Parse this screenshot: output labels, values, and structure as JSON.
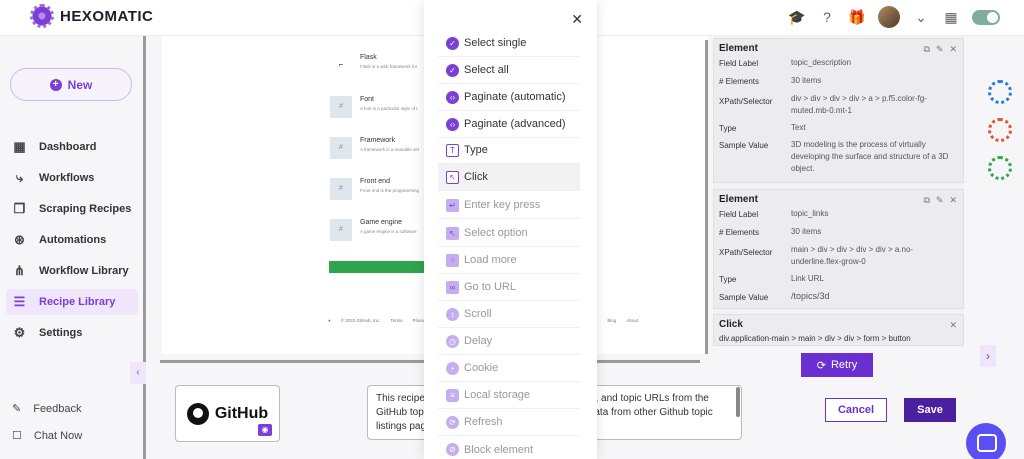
{
  "app": {
    "name": "HEXOMATIC"
  },
  "sidebar": {
    "new_label": "New",
    "items": [
      {
        "label": "Dashboard",
        "icon": "dashboard-icon"
      },
      {
        "label": "Workflows",
        "icon": "workflow-icon"
      },
      {
        "label": "Scraping Recipes",
        "icon": "recipe-icon"
      },
      {
        "label": "Automations",
        "icon": "automation-icon"
      },
      {
        "label": "Workflow Library",
        "icon": "library-icon"
      },
      {
        "label": "Recipe Library",
        "icon": "recipe-library-icon",
        "active": true
      },
      {
        "label": "Settings",
        "icon": "gear-icon"
      }
    ],
    "footer": [
      {
        "label": "Feedback",
        "icon": "feedback-icon"
      },
      {
        "label": "Chat Now",
        "icon": "chat-icon"
      }
    ]
  },
  "preview": {
    "items": [
      {
        "title": "Flask",
        "desc": "Flask is a web framework for"
      },
      {
        "title": "Font",
        "desc": "A font is a particular style of t"
      },
      {
        "title": "Framework",
        "desc": "A framework is a reusable set"
      },
      {
        "title": "Front end",
        "desc": "Front end is the programming"
      },
      {
        "title": "Game engine",
        "desc": "A game engine is a software"
      }
    ],
    "footer": [
      "© 2022 GitHub, Inc.",
      "Terms",
      "Privacy",
      "Blog",
      "About"
    ]
  },
  "modal": {
    "options": [
      {
        "label": "Select single",
        "icon": "check-icon"
      },
      {
        "label": "Select all",
        "icon": "check-all-icon"
      },
      {
        "label": "Paginate (automatic)",
        "icon": "paginate-icon"
      },
      {
        "label": "Paginate (advanced)",
        "icon": "paginate-advanced-icon"
      },
      {
        "label": "Type",
        "icon": "keyboard-icon"
      },
      {
        "label": "Click",
        "icon": "cursor-click-icon"
      },
      {
        "label": "Enter key press",
        "icon": "enter-key-icon"
      },
      {
        "label": "Select option",
        "icon": "pointer-icon"
      },
      {
        "label": "Load more",
        "icon": "spinner-icon"
      },
      {
        "label": "Go to URL",
        "icon": "link-icon"
      },
      {
        "label": "Scroll",
        "icon": "scroll-icon"
      },
      {
        "label": "Delay",
        "icon": "clock-icon"
      },
      {
        "label": "Cookie",
        "icon": "cookie-icon"
      },
      {
        "label": "Local storage",
        "icon": "storage-icon"
      },
      {
        "label": "Refresh",
        "icon": "refresh-icon"
      },
      {
        "label": "Block element",
        "icon": "block-icon"
      }
    ]
  },
  "elements": [
    {
      "title": "Element",
      "field_label_key": "Field Label",
      "field_label": "topic_description",
      "count_key": "# Elements",
      "count": "30 items",
      "xpath_key": "XPath/Selector",
      "xpath": "div > div > div > div > a > p.f5.color-fg-muted.mb-0.mt-1",
      "type_key": "Type",
      "type": "Text",
      "sample_key": "Sample Value",
      "sample": "3D modeling is the process of virtually developing the surface and structure of a 3D object."
    },
    {
      "title": "Element",
      "field_label_key": "Field Label",
      "field_label": "topic_links",
      "count_key": "# Elements",
      "count": "30 items",
      "xpath_key": "XPath/Selector",
      "xpath": "main > div > div > div > div > a.no-underline.flex-grow-0",
      "type_key": "Type",
      "type": "Link URL",
      "sample_key": "Sample Value",
      "sample": "/topics/3d"
    }
  ],
  "click_card": {
    "title": "Click",
    "selector": "div.application-main > main > div > div > form > button"
  },
  "retry_label": "Retry",
  "bottom": {
    "logo_text": "GitHub",
    "description": "This recipe … ns, and topic URLs from the GitHub top … data from other Github topic listings pag…",
    "desc_line1_a": "This recipe",
    "desc_line1_b": "ns, and topic URLs from the",
    "desc_line2_a": "GitHub top",
    "desc_line2_b": "data from other Github topic",
    "desc_line3_a": "listings pag",
    "cancel_label": "Cancel",
    "save_label": "Save"
  },
  "colors": {
    "accent": "#7b3fd4",
    "save": "#4a1fa0",
    "chat": "#5a4ff3"
  }
}
